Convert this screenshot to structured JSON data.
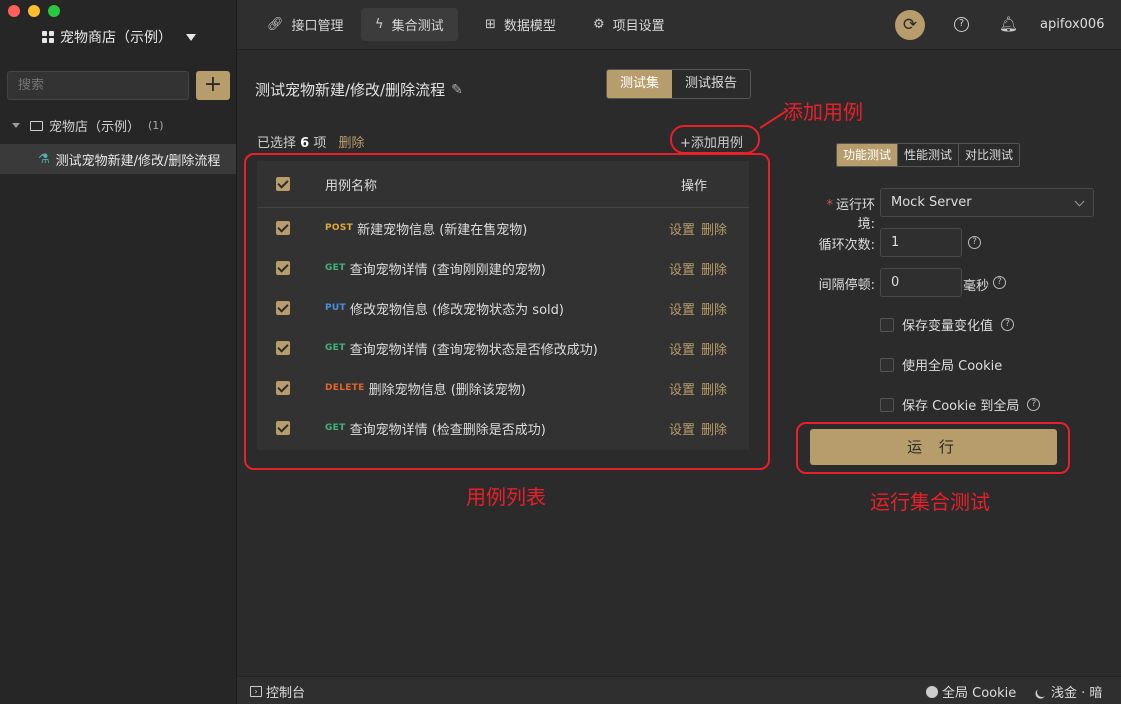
{
  "sidebar": {
    "project_name": "宠物商店（示例）",
    "search_placeholder": "搜索",
    "add_label": "+",
    "folder": {
      "name": "宠物店（示例）",
      "count": "(1)"
    },
    "item": {
      "name": "测试宠物新建/修改/删除流程"
    }
  },
  "topbar": {
    "tabs": [
      {
        "label": "接口管理",
        "icon": "link-icon"
      },
      {
        "label": "集合测试",
        "icon": "lightning-icon"
      },
      {
        "label": "数据模型",
        "icon": "model-icon"
      },
      {
        "label": "项目设置",
        "icon": "gear-icon"
      }
    ],
    "user": "apifox006"
  },
  "main": {
    "title": "测试宠物新建/修改/删除流程",
    "view_tabs": [
      "测试集",
      "测试报告"
    ],
    "selected_prefix": "已选择",
    "selected_count": "6",
    "selected_suffix": "项",
    "delete_label": "删除",
    "add_case_label": "+添加用例",
    "table": {
      "col_name": "用例名称",
      "col_ops": "操作",
      "rows": [
        {
          "method": "POST",
          "name": "新建宠物信息 (新建在售宠物)",
          "op_set": "设置",
          "op_del": "删除"
        },
        {
          "method": "GET",
          "name": "查询宠物详情 (查询刚刚建的宠物)",
          "op_set": "设置",
          "op_del": "删除"
        },
        {
          "method": "PUT",
          "name": "修改宠物信息 (修改宠物状态为 sold)",
          "op_set": "设置",
          "op_del": "删除"
        },
        {
          "method": "GET",
          "name": "查询宠物详情 (查询宠物状态是否修改成功)",
          "op_set": "设置",
          "op_del": "删除"
        },
        {
          "method": "DELETE",
          "name": "删除宠物信息 (删除该宠物)",
          "op_set": "设置",
          "op_del": "删除"
        },
        {
          "method": "GET",
          "name": "查询宠物详情 (检查删除是否成功)",
          "op_set": "设置",
          "op_del": "删除"
        }
      ]
    }
  },
  "run_panel": {
    "modes": [
      "功能测试",
      "性能测试",
      "对比测试"
    ],
    "env_label": "运行环境:",
    "env_value": "Mock Server",
    "loop_label": "循环次数:",
    "loop_value": "1",
    "interval_label": "间隔停顿:",
    "interval_value": "0",
    "interval_unit": "毫秒",
    "options": [
      "保存变量变化值",
      "使用全局 Cookie",
      "保存 Cookie 到全局"
    ],
    "run_label": "运 行"
  },
  "annotations": {
    "add_case": "添加用例",
    "case_list": "用例列表",
    "run_suite": "运行集合测试"
  },
  "bottombar": {
    "console": "控制台",
    "cookie": "全局 Cookie",
    "theme": "浅金 · 暗"
  },
  "colors": {
    "accent": "#b89d6c",
    "annotation_red": "#e8202a",
    "post": "#e2a83a",
    "get": "#3fb27f",
    "put": "#4c8ee0",
    "delete": "#e2652e"
  }
}
